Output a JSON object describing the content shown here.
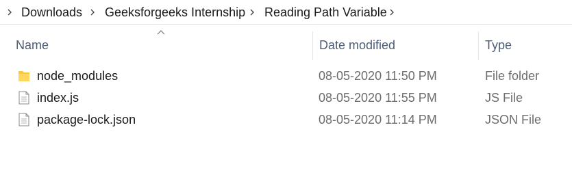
{
  "breadcrumb": {
    "items": [
      {
        "label": "Downloads"
      },
      {
        "label": "Geeksforgeeks Internship"
      },
      {
        "label": "Reading Path Variable"
      }
    ]
  },
  "columns": {
    "name": "Name",
    "date_modified": "Date modified",
    "type": "Type",
    "sorted_by": "name",
    "sort_direction": "ascending"
  },
  "files": [
    {
      "name": "node_modules",
      "date_modified": "08-05-2020 11:50 PM",
      "type": "File folder",
      "icon": "folder-icon"
    },
    {
      "name": "index.js",
      "date_modified": "08-05-2020 11:55 PM",
      "type": "JS File",
      "icon": "file-icon"
    },
    {
      "name": "package-lock.json",
      "date_modified": "08-05-2020 11:14 PM",
      "type": "JSON File",
      "icon": "file-icon"
    }
  ],
  "colors": {
    "folder": "#f8c93b",
    "header_text": "#4d5d75",
    "secondary_text": "#6d6d6d"
  }
}
